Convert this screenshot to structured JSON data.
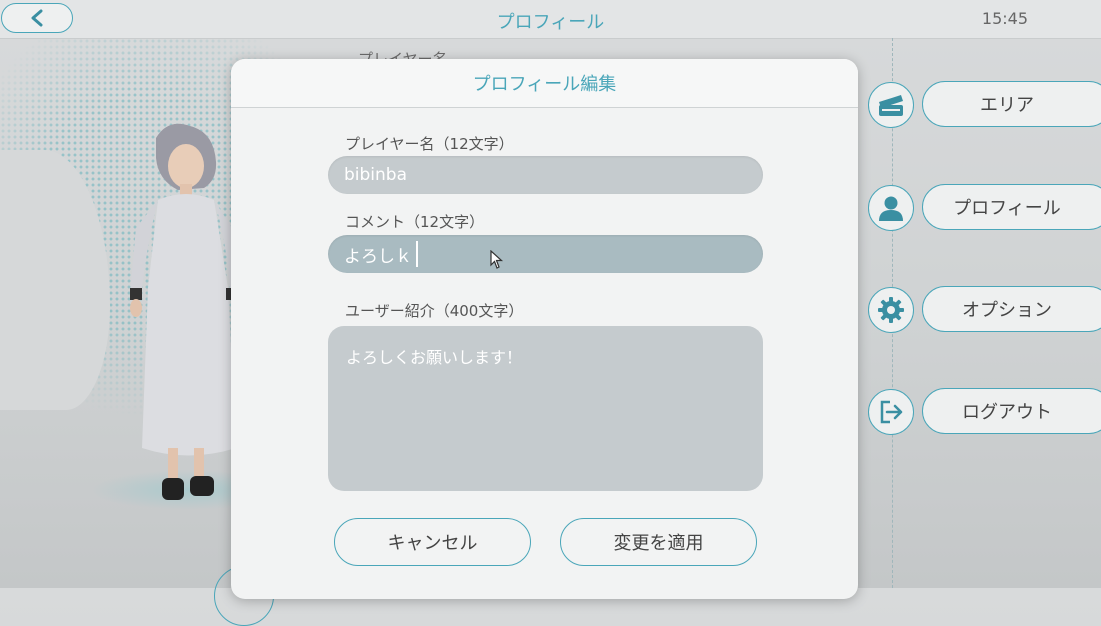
{
  "header": {
    "title": "プロフィール",
    "time": "15:45"
  },
  "background": {
    "partial_label": "プレイヤー名"
  },
  "menu": [
    {
      "icon": "area-card-icon",
      "label": "エリア"
    },
    {
      "icon": "person-icon",
      "label": "プロフィール"
    },
    {
      "icon": "gear-icon",
      "label": "オプション"
    },
    {
      "icon": "logout-icon",
      "label": "ログアウト"
    }
  ],
  "dialog": {
    "title": "プロフィール編集",
    "player_name": {
      "label": "プレイヤー名（12文字）",
      "value": "bibinba"
    },
    "comment": {
      "label": "コメント（12文字）",
      "value": "よろしｋ"
    },
    "bio": {
      "label": "ユーザー紹介（400文字）",
      "value": "よろしくお願いします！"
    },
    "cancel_label": "キャンセル",
    "apply_label": "変更を適用"
  },
  "colors": {
    "accent": "#4aa6b9",
    "field_bg": "#c5cbce",
    "active_field_bg": "#a9bbc1"
  }
}
